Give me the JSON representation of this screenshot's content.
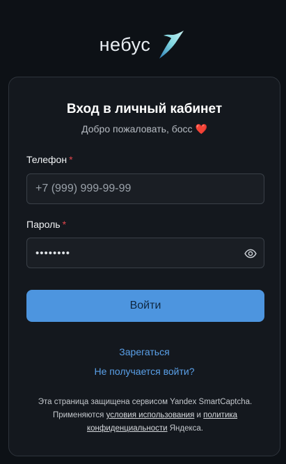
{
  "logo": {
    "text": "небус"
  },
  "card": {
    "title": "Вход в личный кабинет",
    "subtitle": "Добро пожаловать, босс",
    "subtitle_emoji": "❤️"
  },
  "phone": {
    "label": "Телефон",
    "required_mark": "*",
    "placeholder": "+7 (999) 999-99-99",
    "value": ""
  },
  "password": {
    "label": "Пароль",
    "required_mark": "*",
    "masked_value": "••••••••",
    "toggle_icon": "eye-icon"
  },
  "submit": {
    "label": "Войти"
  },
  "links": {
    "register": "Зарегаться",
    "trouble": "Не получается войти?"
  },
  "captcha_notice": {
    "line1": "Эта страница защищена сервисом Yandex SmartCaptcha.",
    "line2_prefix": "Применяются",
    "terms_link": "условия использования",
    "and": "и",
    "policy_link_part1": "политика",
    "policy_link_part2": "конфиденциальности",
    "suffix": "Яндекса."
  },
  "colors": {
    "background": "#0d1116",
    "card": "#14181e",
    "accent": "#4d95df",
    "link": "#5aa0e8",
    "required": "#e3454c"
  }
}
